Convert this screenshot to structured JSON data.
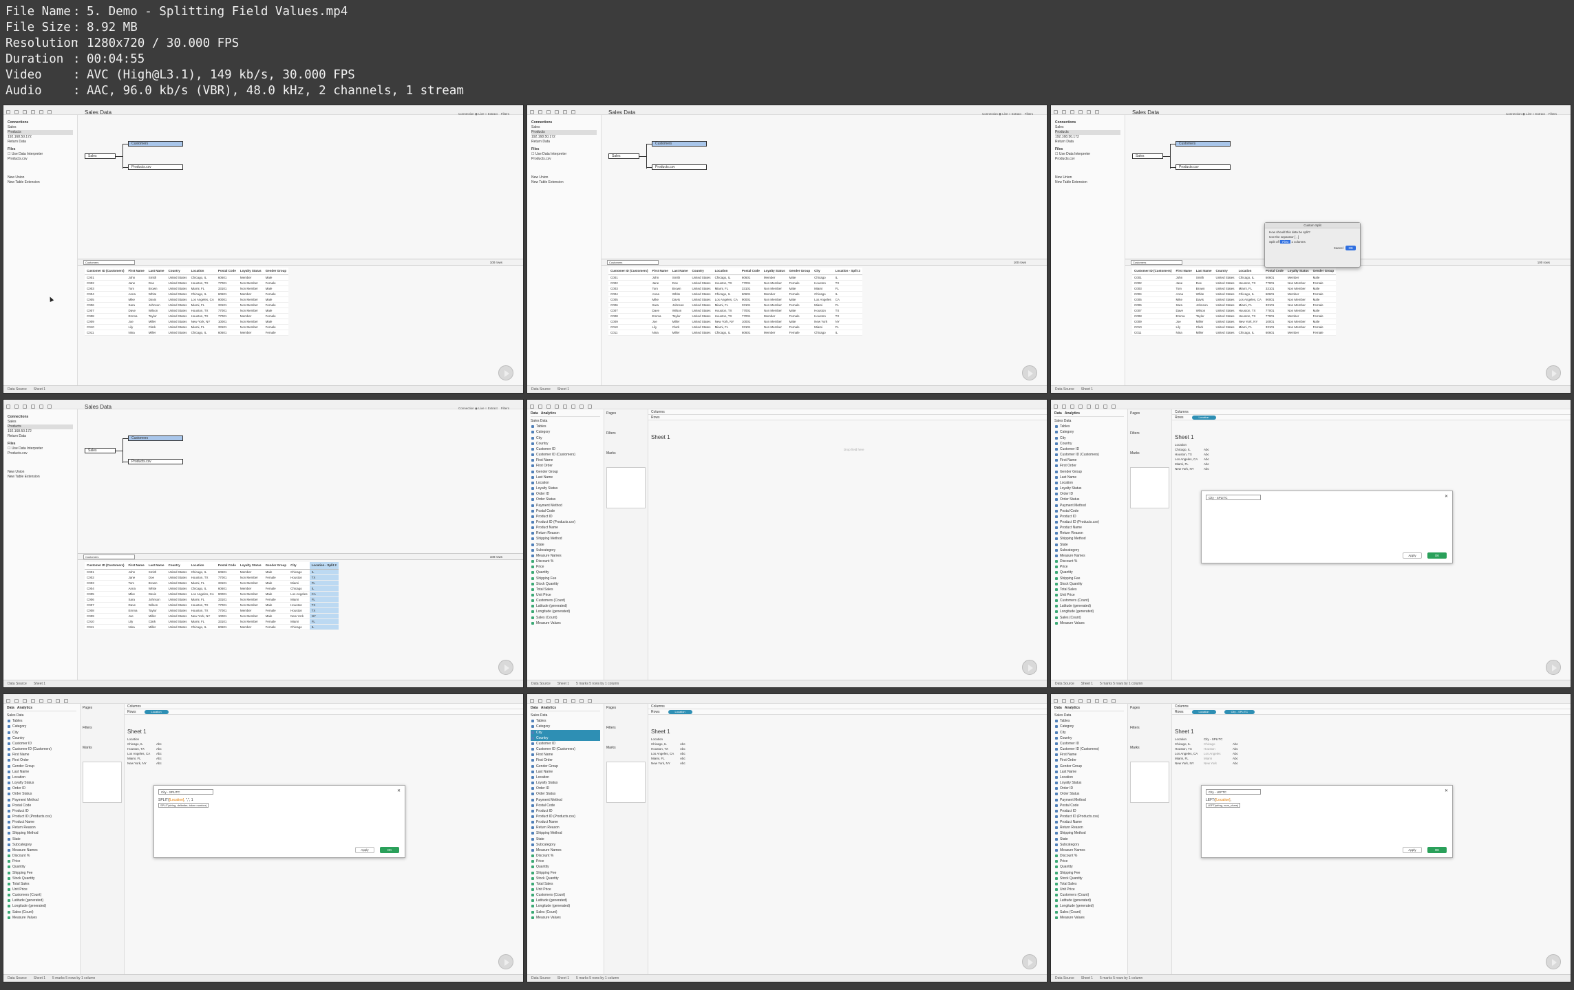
{
  "info": {
    "rows": [
      {
        "key": "File Name",
        "value": "5. Demo - Splitting Field Values.mp4"
      },
      {
        "key": "File Size",
        "value": "8.92 MB"
      },
      {
        "key": "Resolution",
        "value": "1280x720 / 30.000 FPS"
      },
      {
        "key": "Duration",
        "value": "00:04:55"
      },
      {
        "key": "Video",
        "value": "AVC (High@L3.1), 149 kb/s, 30.000 FPS"
      },
      {
        "key": "Audio",
        "value": "AAC, 96.0 kb/s (VBR), 48.0 kHz, 2 channels, 1 stream"
      }
    ]
  },
  "ds": {
    "title": "Sales Data",
    "connections_label": "Connections",
    "add_label": "Add",
    "conn_items": [
      "Sales",
      "Products",
      "192.168.50.172",
      "Return Data"
    ],
    "files_label": "Files",
    "interpreter_label": "Use Data Interpreter",
    "products_csv": "Products.csv",
    "new_union": "New Union",
    "new_table_ext": "New Table Extension",
    "connection_label": "Connection",
    "live_label": "Live",
    "extract_label": "Extract",
    "filters_label": "Filters",
    "tables": {
      "sales": "Sales",
      "customers": "Customers",
      "products": "Products.csv"
    },
    "grid_select": "Customers",
    "rows_label": "rows",
    "rows_value": "100",
    "headers": [
      "Customer ID (Customers)",
      "First Name",
      "Last Name",
      "Country",
      "Location",
      "Postal Code",
      "Loyalty Status",
      "Gender Group"
    ],
    "split_headers": [
      "City",
      "Location - Split 2"
    ],
    "rows": [
      [
        "C001",
        "John",
        "Smith",
        "United States",
        "Chicago, IL",
        "60601",
        "Member",
        "Male",
        "Chicago",
        "IL"
      ],
      [
        "C002",
        "Jane",
        "Doe",
        "United States",
        "Houston, TX",
        "77001",
        "Non Member",
        "Female",
        "Houston",
        "TX"
      ],
      [
        "C003",
        "Tom",
        "Brown",
        "United States",
        "Miami, FL",
        "33101",
        "Non Member",
        "Male",
        "Miami",
        "FL"
      ],
      [
        "C004",
        "Anna",
        "White",
        "United States",
        "Chicago, IL",
        "60601",
        "Member",
        "Female",
        "Chicago",
        "IL"
      ],
      [
        "C005",
        "Mike",
        "Davis",
        "United States",
        "Los Angeles, CA",
        "90001",
        "Non Member",
        "Male",
        "Los Angeles",
        "CA"
      ],
      [
        "C006",
        "Sara",
        "Johnson",
        "United States",
        "Miami, FL",
        "33101",
        "Non Member",
        "Female",
        "Miami",
        "FL"
      ],
      [
        "C007",
        "Dave",
        "Wilson",
        "United States",
        "Houston, TX",
        "77001",
        "Non Member",
        "Male",
        "Houston",
        "TX"
      ],
      [
        "C008",
        "Emma",
        "Taylor",
        "United States",
        "Houston, TX",
        "77001",
        "Member",
        "Female",
        "Houston",
        "TX"
      ],
      [
        "C009",
        "Joe",
        "Miller",
        "United States",
        "New York, NY",
        "10001",
        "Non Member",
        "Male",
        "New York",
        "NY"
      ],
      [
        "C010",
        "Lily",
        "Clark",
        "United States",
        "Miami, FL",
        "33101",
        "Non Member",
        "Female",
        "Miami",
        "FL"
      ],
      [
        "C011",
        "Nina",
        "Miller",
        "United States",
        "Chicago, IL",
        "60601",
        "Member",
        "Female",
        "Chicago",
        "IL"
      ]
    ],
    "bottom_tabs": [
      "Data Source",
      "Sheet 1"
    ]
  },
  "custom_split": {
    "title": "Custom Split",
    "question": "How should this data be split?",
    "separator_label": "Use the separator",
    "split_off_label": "Split off",
    "option": "First",
    "columns_label": "columns",
    "count": "1",
    "cancel": "Cancel",
    "ok": "OK"
  },
  "ws": {
    "data_tab": "Data",
    "analytics_tab": "Analytics",
    "pages": "Pages",
    "filters": "Filters",
    "marks": "Marks",
    "columns": "Columns",
    "rows": "Rows",
    "source": "Sales Data",
    "sheet_title": "Sheet 1",
    "fields": [
      "Tables",
      "Category",
      "City",
      "Country",
      "Customer ID",
      "Customer ID (Customers)",
      "First Name",
      "First Order",
      "Gender Group",
      "Last Name",
      "Location",
      "Loyalty Status",
      "Order ID",
      "Order Status",
      "Payment Method",
      "Postal Code",
      "Product ID",
      "Product ID (Products.csv)",
      "Product Name",
      "Return Reason",
      "Shipping Method",
      "State",
      "Subcategory",
      "Measure Names"
    ],
    "measures": [
      "Discount %",
      "Price",
      "Quantity",
      "Shipping Fee",
      "Stock Quantity",
      "Total Sales",
      "Unit Price",
      "Customers (Count)",
      "Latitude (generated)",
      "Longitude (generated)",
      "Sales (Count)",
      "Measure Values"
    ],
    "location_pill": "Location",
    "split_pill": "City - SPLITC",
    "location_header": "Location",
    "city_header": "City - SPLITC",
    "locations": [
      "Chicago, IL",
      "Houston, TX",
      "Los Angeles, CA",
      "Miami, FL",
      "New York, NY"
    ],
    "cities": [
      "Chicago",
      "Houston",
      "Los Angeles",
      "Miami",
      "New York"
    ],
    "abc": "Abc",
    "calc_name": "City - SPLITC",
    "calc_name2": "City - LEFTC",
    "code1_fn": "SPLIT(",
    "code1_arg": "[Location]",
    "code1_rest": ", \",\", 1",
    "tip1": "SPLIT(string, delimiter, token number)",
    "code2_fn": "LEFT(",
    "code2_arg": "[Location]",
    "code2_rest": ",",
    "tip2": "LEFT(string, num_chars)",
    "apply": "Apply",
    "ok": "OK",
    "status": "5 marks    5 rows by 1 column",
    "drop_field": "Drop field here"
  }
}
